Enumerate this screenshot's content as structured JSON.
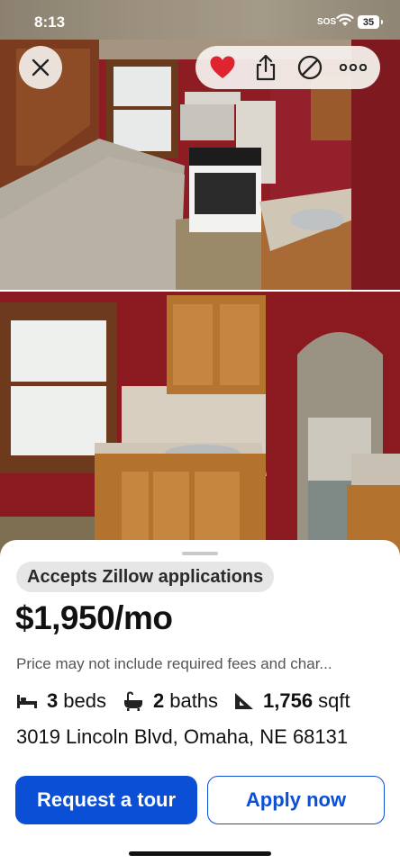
{
  "status_bar": {
    "time": "8:13",
    "sos": "SOS",
    "battery": "35"
  },
  "photos": [
    {
      "icon": "kitchen-photo-range-counter"
    },
    {
      "icon": "kitchen-photo-sink-cabinets"
    }
  ],
  "toolbar": {
    "close_icon": "close-icon",
    "favorite_icon": "heart-icon",
    "share_icon": "share-icon",
    "hide_icon": "hide-icon",
    "more_icon": "more-icon",
    "favorite_color": "#e0242f"
  },
  "listing": {
    "badge": "Accepts Zillow applications",
    "price": "$1,950/mo",
    "disclaimer": "Price may not include required fees and char...",
    "beds_value": "3",
    "beds_label": "beds",
    "baths_value": "2",
    "baths_label": "baths",
    "sqft_value": "1,756",
    "sqft_label": "sqft",
    "address": "3019 Lincoln Blvd, Omaha, NE 68131"
  },
  "actions": {
    "request_tour": "Request a tour",
    "apply_now": "Apply now",
    "accent_color": "#0a4fd6"
  }
}
